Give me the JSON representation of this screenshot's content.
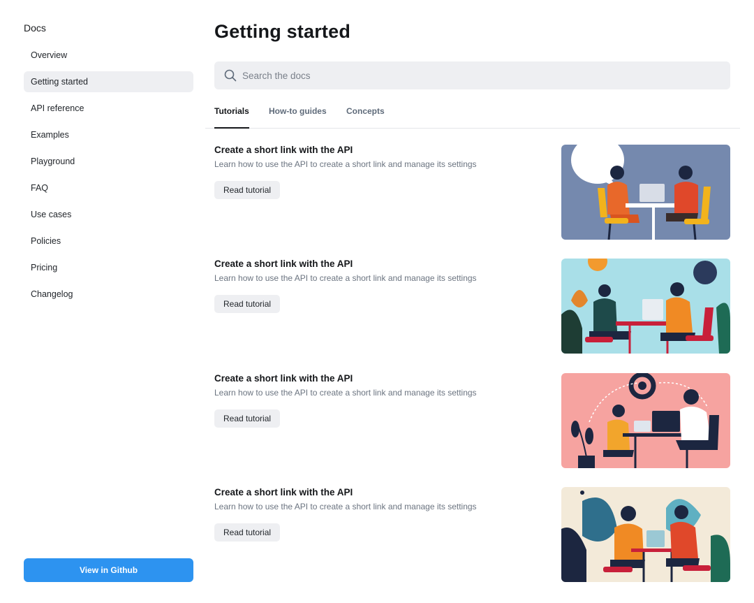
{
  "sidebar": {
    "title": "Docs",
    "items": [
      {
        "label": "Overview",
        "active": false
      },
      {
        "label": "Getting started",
        "active": true
      },
      {
        "label": "API reference",
        "active": false
      },
      {
        "label": "Examples",
        "active": false
      },
      {
        "label": "Playground",
        "active": false
      },
      {
        "label": "FAQ",
        "active": false
      },
      {
        "label": "Use cases",
        "active": false
      },
      {
        "label": "Policies",
        "active": false
      },
      {
        "label": "Pricing",
        "active": false
      },
      {
        "label": "Changelog",
        "active": false
      }
    ],
    "github_button": "View in Github"
  },
  "main": {
    "title": "Getting started",
    "search": {
      "placeholder": "Search the docs",
      "value": ""
    },
    "tabs": [
      {
        "label": "Tutorials",
        "active": true
      },
      {
        "label": "How-to guides",
        "active": false
      },
      {
        "label": "Concepts",
        "active": false
      }
    ],
    "cards": [
      {
        "title": "Create a short link with the API",
        "description": "Learn how to use the API to create a short link and manage its settings",
        "button": "Read tutorial",
        "image_bg": "#7589ae"
      },
      {
        "title": "Create a short link with the API",
        "description": "Learn how to use the API to create a short link and manage its settings",
        "button": "Read tutorial",
        "image_bg": "#a9dfe8"
      },
      {
        "title": "Create a short link with the API",
        "description": "Learn how to use the API to create a short link and manage its settings",
        "button": "Read tutorial",
        "image_bg": "#f6a3a0"
      },
      {
        "title": "Create a short link with the API",
        "description": "Learn how to use the API to create a short link and manage its settings",
        "button": "Read tutorial",
        "image_bg": "#f3ead9"
      }
    ]
  },
  "colors": {
    "accent": "#2d93f0",
    "active_bg": "#eeeff2",
    "muted_text": "#6b7480"
  },
  "icons": {
    "search": "search-icon"
  }
}
